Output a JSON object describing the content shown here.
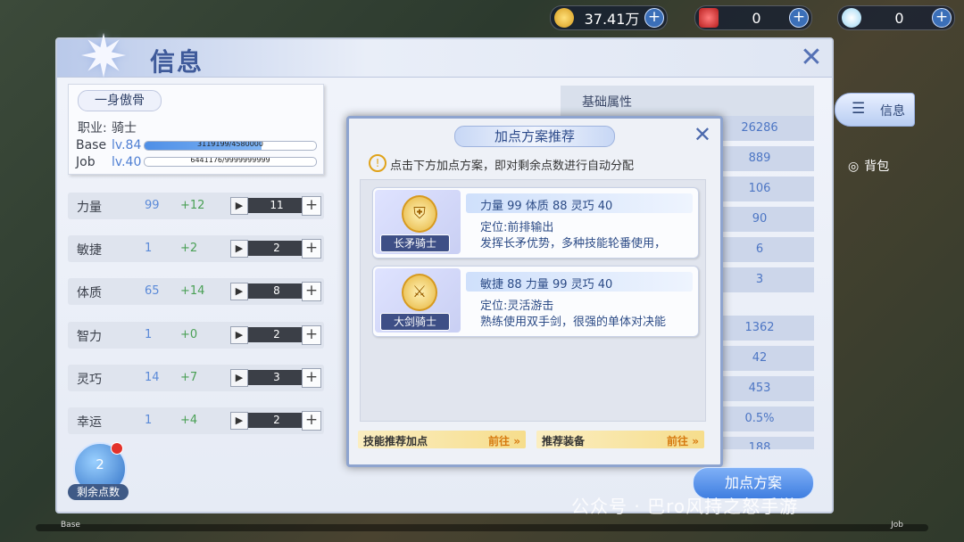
{
  "currency": {
    "coins": "37.41万",
    "gems": "0",
    "diamonds": "0"
  },
  "window": {
    "title": "信息"
  },
  "character": {
    "nickname": "一身傲骨",
    "job_label": "职业:",
    "job_value": "骑士",
    "base_label": "Base",
    "base_level": "lv.84",
    "base_exp": "3119199/4580000",
    "base_progress": 0.681,
    "job_label2": "Job",
    "job_level": "lv.40",
    "job_exp": "6441176/9999999999",
    "job_progress": 0.0006
  },
  "stats": [
    {
      "name": "力量",
      "base": "99",
      "bonus": "+12",
      "alloc": "11"
    },
    {
      "name": "敏捷",
      "base": "1",
      "bonus": "+2",
      "alloc": "2"
    },
    {
      "name": "体质",
      "base": "65",
      "bonus": "+14",
      "alloc": "8"
    },
    {
      "name": "智力",
      "base": "1",
      "bonus": "+0",
      "alloc": "2"
    },
    {
      "name": "灵巧",
      "base": "14",
      "bonus": "+7",
      "alloc": "3"
    },
    {
      "name": "幸运",
      "base": "1",
      "bonus": "+4",
      "alloc": "2"
    }
  ],
  "points": {
    "value": "2",
    "label": "剩余点数"
  },
  "basic_attr": {
    "title": "基础属性",
    "values": [
      "26286",
      "889",
      "106",
      "90",
      "6",
      "3",
      "1362",
      "42",
      "453",
      "0.5%",
      "188"
    ]
  },
  "side": {
    "info": "信息",
    "bag": "背包"
  },
  "modal": {
    "title": "加点方案推荐",
    "note": "点击下方加点方案，即对剩余点数进行自动分配",
    "plans": [
      {
        "role": "长矛骑士",
        "stats": "力量 99 体质 88 灵巧 40",
        "line1": "定位:前排输出",
        "line2": "发挥长矛优势，多种技能轮番使用，"
      },
      {
        "role": "大剑骑士",
        "stats": "敏捷 88 力量 99 灵巧 40",
        "line1": "定位:灵活游击",
        "line2": "熟练使用双手剑，很强的单体对决能"
      }
    ],
    "go1_label": "技能推荐加点",
    "go1_action": "前往",
    "go2_label": "推荐装备",
    "go2_action": "前往"
  },
  "plan_button": "加点方案",
  "watermark": "公众号 · 巴ro风持之怒手游",
  "bottom": {
    "left": "Base",
    "right": "Job"
  }
}
